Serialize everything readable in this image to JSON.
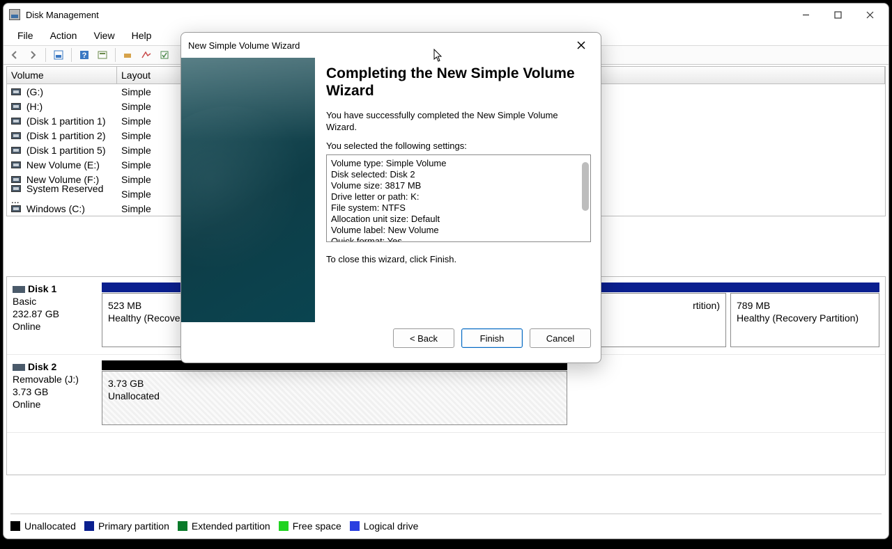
{
  "app": {
    "title": "Disk Management"
  },
  "menu": {
    "file": "File",
    "action": "Action",
    "view": "View",
    "help": "Help"
  },
  "table": {
    "col_volume": "Volume",
    "col_layout": "Layout",
    "rows": [
      {
        "vol": " (G:)",
        "layout": "Simple"
      },
      {
        "vol": " (H:)",
        "layout": "Simple"
      },
      {
        "vol": " (Disk 1 partition 1)",
        "layout": "Simple"
      },
      {
        "vol": " (Disk 1 partition 2)",
        "layout": "Simple"
      },
      {
        "vol": " (Disk 1 partition 5)",
        "layout": "Simple"
      },
      {
        "vol": " New Volume (E:)",
        "layout": "Simple"
      },
      {
        "vol": " New Volume (F:)",
        "layout": "Simple"
      },
      {
        "vol": " System Reserved ...",
        "layout": "Simple"
      },
      {
        "vol": " Windows (C:)",
        "layout": "Simple"
      }
    ]
  },
  "disks": {
    "d1": {
      "name": "Disk 1",
      "type": "Basic",
      "size": "232.87 GB",
      "status": "Online",
      "parts": [
        {
          "size": "523 MB",
          "status": "Healthy (Recovery Partition)"
        },
        {
          "size": "",
          "status": "rtition)"
        },
        {
          "size": "789 MB",
          "status": "Healthy (Recovery Partition)"
        }
      ]
    },
    "d2": {
      "name": "Disk 2",
      "type": "Removable (J:)",
      "size": "3.73 GB",
      "status": "Online",
      "part_size": "3.73 GB",
      "part_status": "Unallocated"
    }
  },
  "legend": {
    "unalloc": "Unallocated",
    "primary": "Primary partition",
    "ext": "Extended partition",
    "free": "Free space",
    "logical": "Logical drive"
  },
  "wizard": {
    "title": "New Simple Volume Wizard",
    "heading": "Completing the New Simple Volume Wizard",
    "intro": "You have successfully completed the New Simple Volume Wizard.",
    "settings_label": "You selected the following settings:",
    "settings": [
      "Volume type: Simple Volume",
      "Disk selected: Disk 2",
      "Volume size: 3817 MB",
      "Drive letter or path: K:",
      "File system: NTFS",
      "Allocation unit size: Default",
      "Volume label: New Volume",
      "Quick format: Yes"
    ],
    "close_hint": "To close this wizard, click Finish.",
    "back": "< Back",
    "finish": "Finish",
    "cancel": "Cancel"
  }
}
